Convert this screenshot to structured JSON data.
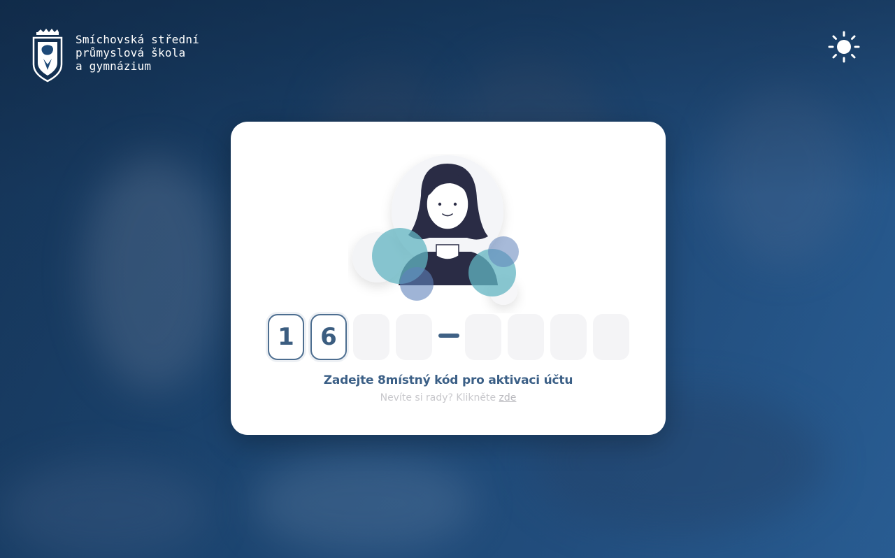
{
  "school": {
    "name_lines": [
      "Smíchovská střední",
      "průmyslová škola",
      "a gymnázium"
    ]
  },
  "theme_toggle": {
    "icon": "sun-icon"
  },
  "activation": {
    "code_boxes": [
      "1",
      "6",
      "",
      "",
      "",
      "",
      "",
      ""
    ],
    "instruction": "Zadejte 8místný kód pro aktivaci účtu",
    "help_prefix": "Nevíte si rady? Klikněte",
    "help_link": "zde"
  },
  "colors": {
    "accent": "#3b5f86",
    "bubble": "#62b4c2",
    "bubble_blue": "#5f82ba",
    "card": "#ffffff",
    "background": "#1e4a78"
  }
}
